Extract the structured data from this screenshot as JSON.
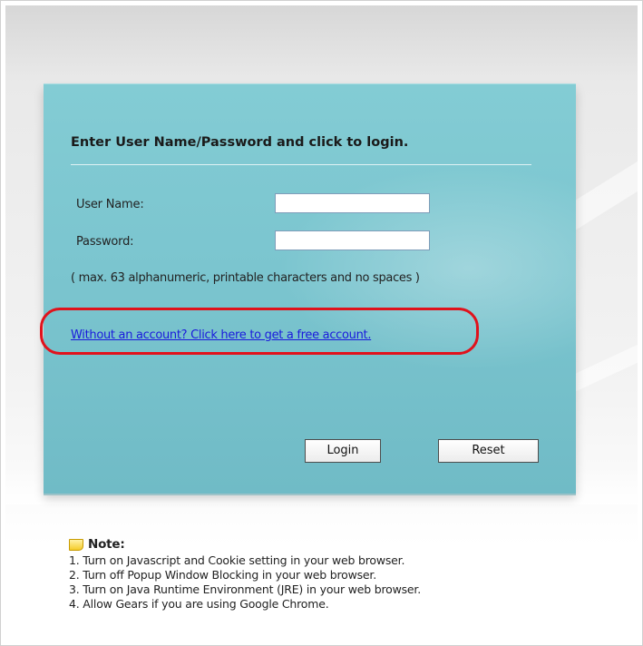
{
  "login": {
    "title": "Enter User Name/Password and click to login.",
    "username_label": "User Name:",
    "username_value": "",
    "password_label": "Password:",
    "password_value": "",
    "hint": "( max. 63 alphanumeric, printable characters and no spaces )",
    "account_link": "Without an account? Click here to get a free account.",
    "login_button": "Login",
    "reset_button": "Reset"
  },
  "note": {
    "heading": "Note:",
    "items": [
      "1. Turn on Javascript and Cookie setting in your web browser.",
      "2. Turn off Popup Window Blocking in your web browser.",
      "3. Turn on Java Runtime Environment (JRE) in your web browser.",
      "4. Allow Gears if you are using Google Chrome."
    ]
  },
  "colors": {
    "panel": "#7bc5cf",
    "link": "#1a1adc",
    "highlight": "#e0121c"
  },
  "icons": {
    "note": "note-icon"
  }
}
